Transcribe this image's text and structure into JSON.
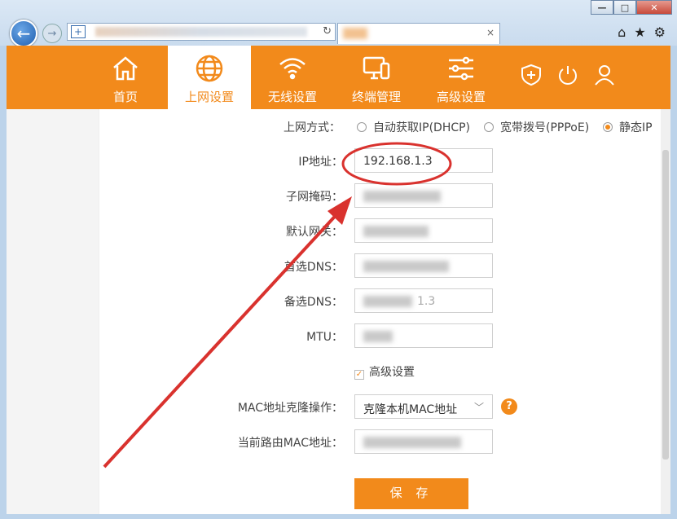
{
  "window_controls": {
    "minimize": "—",
    "maximize": "□",
    "close": "✕"
  },
  "browser": {
    "back_glyph": "←",
    "forward_glyph": "→",
    "reload_glyph": "↻",
    "tab_close": "×",
    "tools": {
      "home": "⌂",
      "favorites": "★",
      "settings": "⚙"
    }
  },
  "nav": {
    "items": [
      {
        "label": "首页",
        "icon": "home-icon"
      },
      {
        "label": "上网设置",
        "icon": "globe-icon",
        "active": true
      },
      {
        "label": "无线设置",
        "icon": "wifi-icon"
      },
      {
        "label": "终端管理",
        "icon": "devices-icon"
      },
      {
        "label": "高级设置",
        "icon": "sliders-icon"
      }
    ],
    "right_icons": [
      "shield-plus-icon",
      "power-icon",
      "user-icon"
    ],
    "accent_color": "#f28a1b"
  },
  "form": {
    "wan_mode": {
      "label": "上网方式：",
      "options": [
        "自动获取IP(DHCP)",
        "宽带拨号(PPPoE)",
        "静态IP"
      ],
      "selected": "静态IP"
    },
    "ip": {
      "label": "IP地址：",
      "value": "192.168.1.3"
    },
    "subnet": {
      "label": "子网掩码："
    },
    "gateway": {
      "label": "默认网关："
    },
    "dns1": {
      "label": "首选DNS："
    },
    "dns2": {
      "label": "备选DNS：",
      "partial": "1.3"
    },
    "mtu": {
      "label": "MTU："
    },
    "advanced": {
      "label": "高级设置",
      "checked": true
    },
    "mac_clone": {
      "label": "MAC地址克隆操作：",
      "selected": "克隆本机MAC地址"
    },
    "current_mac": {
      "label": "当前路由MAC地址："
    },
    "help_glyph": "?",
    "save_label": "保 存"
  },
  "annotation": {
    "color": "#d9322e"
  }
}
